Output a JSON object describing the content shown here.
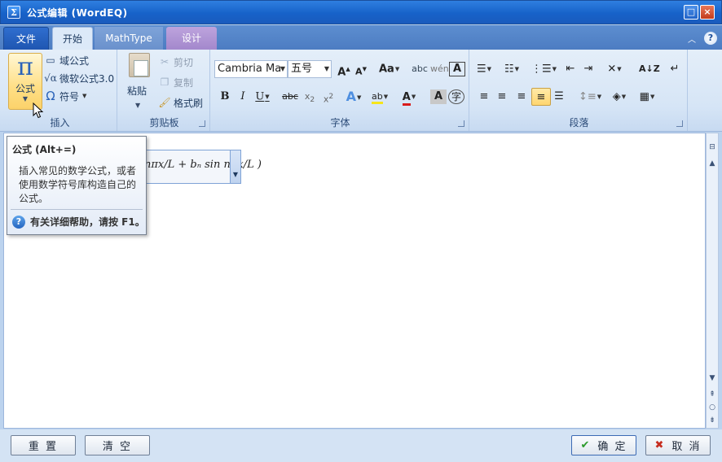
{
  "window": {
    "title": "公式编辑 (WordEQ)",
    "maximize_glyph": "□",
    "close_glyph": "×"
  },
  "tabs": [
    {
      "label": "文件"
    },
    {
      "label": "开始"
    },
    {
      "label": "MathType"
    },
    {
      "label": "设计"
    }
  ],
  "ribbon": {
    "insert": {
      "formula_label": "公式",
      "domain_formula": "域公式",
      "ms_formula": "微软公式3.0",
      "symbol": "符号",
      "group_label": "插入"
    },
    "clipboard": {
      "paste": "粘贴",
      "cut": "剪切",
      "copy": "复制",
      "format_painter": "格式刷",
      "group_label": "剪贴板"
    },
    "font": {
      "font_name": "Cambria Ma",
      "font_size": "五号",
      "group_label": "字体"
    },
    "paragraph": {
      "group_label": "段落"
    }
  },
  "document": {
    "formula_visible_fragment": "nπx/L + bₙ sin nπx/L )"
  },
  "tooltip": {
    "title": "公式 (Alt+=)",
    "description": "插入常见的数学公式，或者使用数学符号库构造自己的公式。",
    "help": "有关详细帮助，请按 F1。"
  },
  "buttons": {
    "reset": "重 置",
    "clear": "清 空",
    "ok": "确 定",
    "cancel": "取 消"
  },
  "colors": {
    "title_bar": "#1762c9",
    "accent_highlight": "#ffdf86",
    "font_color_red": "#d81b1b",
    "highlight_yellow": "#f6e51a"
  }
}
